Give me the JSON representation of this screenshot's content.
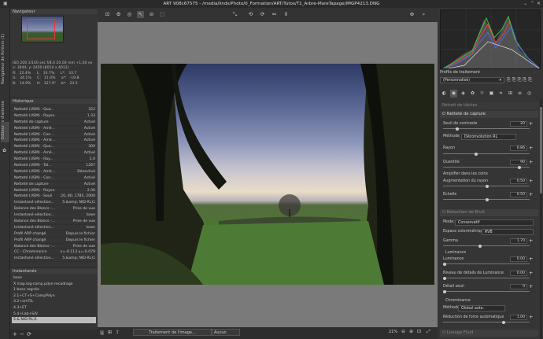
{
  "window": {
    "title": "ART 908c67575 - /media/linds/Photo/0_Formation/ART/Tutos/T1_Arbre-MareTapage/IMGP4213.DNG"
  },
  "vtabs": [
    "Navigateur de fichiers (1)",
    "File d'attente",
    "Editeur"
  ],
  "navigator": {
    "label": "Navigateur",
    "info_line1": "ISO 200   1/100 sec   f/8.0   20.00 mm   +1.00 ev",
    "info_line2": "x: 3844, y: 2450   (6014 x 4012)",
    "r_label": "R:",
    "r_pct": "22.4%",
    "r_l": "L:",
    "r_lv": "33.7%",
    "r_t": "L*:",
    "r_tv": "33.7",
    "g_label": "G:",
    "g_pct": "34.1%",
    "g_l": "C:",
    "g_lv": "11.0%",
    "g_t": "a*:",
    "g_tv": "-19.8",
    "b_label": "B:",
    "b_pct": "14.9%",
    "b_l": "H:",
    "b_lv": "127.9°",
    "b_t": "b*:",
    "b_tv": "24.5"
  },
  "history": {
    "label": "Historique",
    "rows": [
      {
        "name": "Netteté (USM) - Qua...",
        "value": "322"
      },
      {
        "name": "Netteté (USM) - Rayon",
        "value": "1.33"
      },
      {
        "name": "Netteté de capture",
        "value": "Activé"
      },
      {
        "name": "Netteté (USM) - Amé...",
        "value": "Activé"
      },
      {
        "name": "Netteté (USM) - Con...",
        "value": "Activé"
      },
      {
        "name": "Netteté (USM) - Amé...",
        "value": "Activé"
      },
      {
        "name": "Netteté (USM) - Qua...",
        "value": "300"
      },
      {
        "name": "Netteté (USM) - Amé...",
        "value": "Activé"
      },
      {
        "name": "Netteté (USM) - Ray...",
        "value": "2.0"
      },
      {
        "name": "Netteté (USM) - Tol...",
        "value": "1267"
      },
      {
        "name": "Netteté (USM) - Amé...",
        "value": "Désactivé"
      },
      {
        "name": "Netteté (USM) - Con...",
        "value": "Activé"
      },
      {
        "name": "Netteté de capture",
        "value": "Activé"
      },
      {
        "name": "Netteté (USM) - Rayon",
        "value": "2.00"
      },
      {
        "name": "Netteté (USM) - Seuil",
        "value": "20, 80, 1785, 2000"
      },
      {
        "name": "Instantané sélection...",
        "value": "5.&amp; NID-RL)1"
      },
      {
        "name": "Balance des Blancs -...",
        "value": "Prise de vue"
      },
      {
        "name": "Instantané sélection...",
        "value": "base"
      },
      {
        "name": "Balance des Blancs -...",
        "value": "Prise de vue"
      },
      {
        "name": "Instantané sélection...",
        "value": "base"
      },
      {
        "name": "Profil ARP changé",
        "value": "Depuis le fichier"
      },
      {
        "name": "Profil ARP changé",
        "value": "Depuis le fichier"
      },
      {
        "name": "Balance des Blancs -...",
        "value": "Prise de vue"
      },
      {
        "name": "CC - Chrominance",
        "value": "x=-0.113 y=-0.079"
      },
      {
        "name": "Instantané sélection...",
        "value": "5.&amp; NID-RL)1"
      }
    ]
  },
  "snapshots": {
    "label": "Instantanés",
    "rows": [
      "base",
      "X map.log-comp.pdyn-recadrage",
      "1 base rognée",
      "2.1+CT+S+CompPdyn",
      "3.2+omTIL",
      "4.3+ET",
      "5.4+Lab+S/V",
      "5.& NID-RL)1"
    ],
    "selected_index": 7
  },
  "toolbar": {
    "items": [
      "⊡",
      "⚙",
      "◎",
      "↖",
      "⊘",
      "⬚",
      "⤡",
      "⟲",
      "⟳",
      "⇔",
      "⇕",
      "⊕",
      "⌕"
    ]
  },
  "status": {
    "processing": "Traitement de l'image...",
    "zoom": "Aucun",
    "zoom_pct": "21%"
  },
  "right": {
    "profile_label": "Profils de traitement",
    "profile_value": "(Personnalisé)",
    "sections": {
      "retrait": "Retrait de tâches",
      "nettete": "Netteté de capture",
      "reduction": "Réduction de Bruit",
      "lissage": "Lissage Fluid"
    },
    "nc": {
      "seuil_label": "Seuil de contraste",
      "seuil_val": "20",
      "methode_label": "Méthode",
      "methode_val": "Déconvolution RL",
      "rayon_label": "Rayon",
      "rayon_val": "0.86",
      "quantite_label": "Quantité",
      "quantite_val": "90",
      "ampl_label": "Amplifier dans les coins",
      "aug_label": "Augmentation du rayon",
      "aug_val": "0.50",
      "echelle_label": "Echelle",
      "echelle_val": "0.50"
    },
    "rb": {
      "mode_label": "Mode:",
      "mode_val": "Conservatif",
      "espace_label": "Espace colorimétrique:",
      "espace_val": "RVB",
      "gamma_label": "Gamma",
      "gamma_val": "1.70",
      "lum_title": "Luminance",
      "lum_label": "Luminance",
      "lum_val": "0.00",
      "det_label": "Niveau de détails de Luminance",
      "det_val": "0.00",
      "seuil_label": "Détail seuil",
      "seuil_val": "0",
      "chr_title": "Chrominance",
      "meth_label": "Méthode:",
      "meth_val": "Global auto.",
      "red_label": "Réduction de force automatique",
      "red_val": "1.00"
    }
  },
  "colors": {
    "accent_red": "#e13a3a"
  }
}
